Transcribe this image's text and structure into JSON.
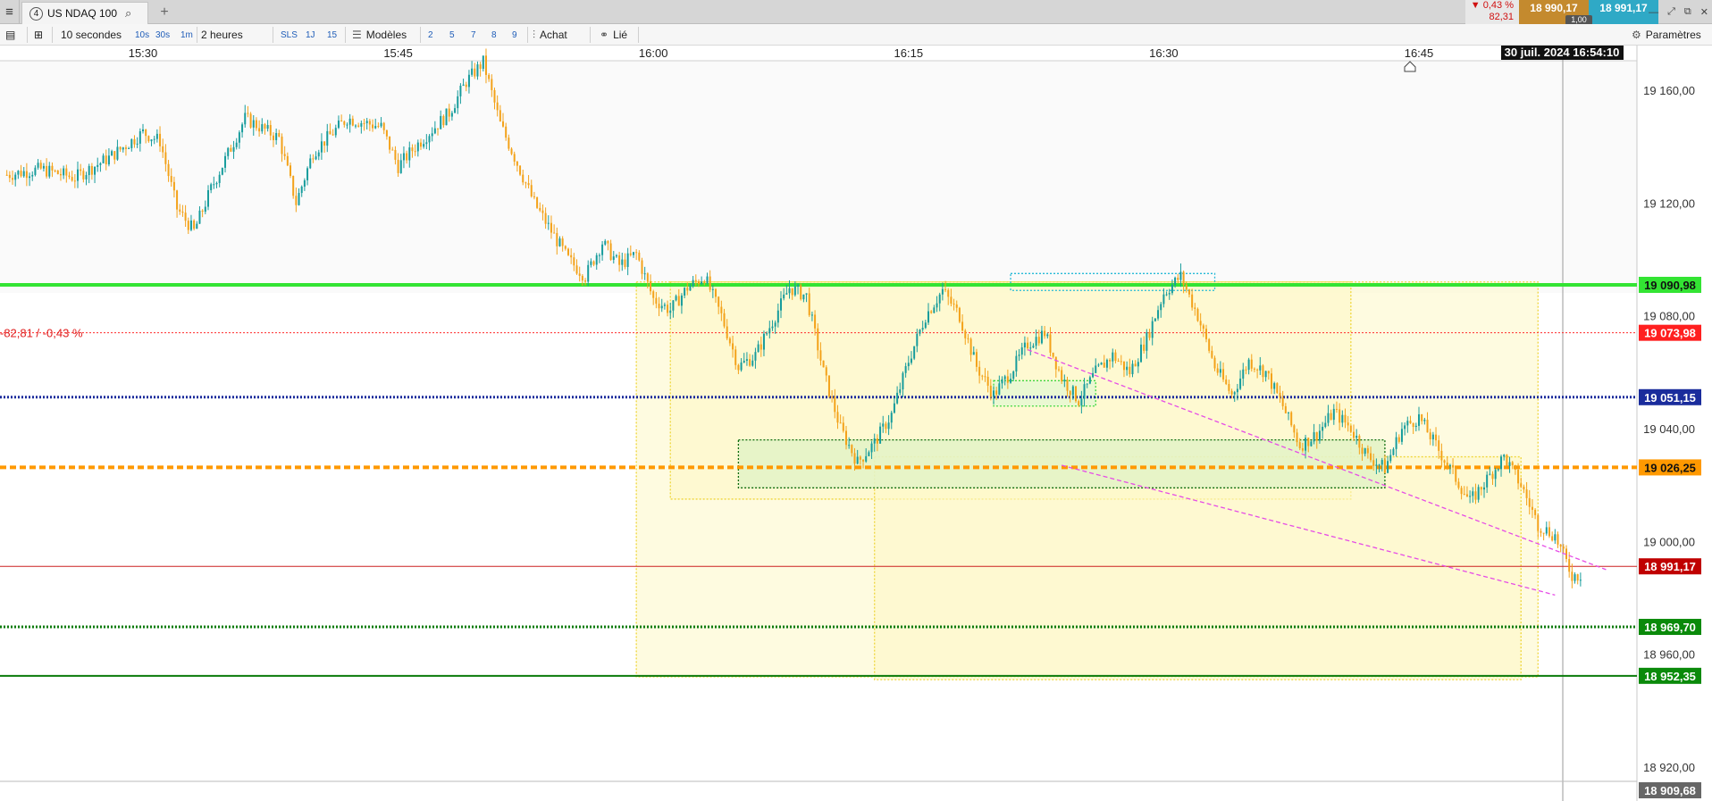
{
  "tab": {
    "number": "4",
    "title": "US NDAQ 100"
  },
  "quote": {
    "change_pct": "▼ 0,43 %",
    "change_pts": "82,31",
    "bid": "18 990,17",
    "ask": "18 991,17",
    "qty": "1,00"
  },
  "toolbar": {
    "interval": "10 secondes",
    "presets": [
      "10s",
      "30s",
      "1m"
    ],
    "range": "2 heures",
    "range_presets": [
      "SLS",
      "1J",
      "15"
    ],
    "models": "Modèles",
    "model_presets": [
      "2",
      "5",
      "7",
      "8",
      "9"
    ],
    "buy": "Achat",
    "linked": "Lié",
    "settings": "Paramètres"
  },
  "chart_data": {
    "type": "candlestick",
    "x_axis": {
      "range": [
        "15:22",
        "16:50"
      ],
      "tick_labels": [
        "15:30",
        "15:45",
        "16:00",
        "16:15",
        "16:30",
        "16:45"
      ]
    },
    "y_axis": {
      "range": [
        18905,
        19178
      ],
      "tick_labels": [
        "19 160,00",
        "19 120,00",
        "19 080,00",
        "19 040,00",
        "19 000,00",
        "18 960,00",
        "18 920,00"
      ],
      "side": "right"
    },
    "crosshair_time": "30 juil. 2024 16:54:10",
    "price_path": [
      [
        "15:22",
        19130
      ],
      [
        "15:24",
        19132
      ],
      [
        "15:26",
        19129
      ],
      [
        "15:28",
        19136
      ],
      [
        "15:30",
        19145
      ],
      [
        "15:31",
        19142
      ],
      [
        "15:32",
        19118
      ],
      [
        "15:33",
        19110
      ],
      [
        "15:34",
        19125
      ],
      [
        "15:36",
        19150
      ],
      [
        "15:38",
        19143
      ],
      [
        "15:39",
        19120
      ],
      [
        "15:40",
        19138
      ],
      [
        "15:42",
        19150
      ],
      [
        "15:44",
        19147
      ],
      [
        "15:45",
        19133
      ],
      [
        "15:46",
        19140
      ],
      [
        "15:48",
        19152
      ],
      [
        "15:49",
        19163
      ],
      [
        "15:50",
        19170
      ],
      [
        "15:51",
        19148
      ],
      [
        "15:52",
        19134
      ],
      [
        "15:53",
        19120
      ],
      [
        "15:54",
        19110
      ],
      [
        "15:55",
        19100
      ],
      [
        "15:56",
        19094
      ],
      [
        "15:57",
        19106
      ],
      [
        "15:58",
        19098
      ],
      [
        "15:59",
        19102
      ],
      [
        "16:00",
        19086
      ],
      [
        "16:01",
        19082
      ],
      [
        "16:02",
        19090
      ],
      [
        "16:03",
        19094
      ],
      [
        "16:04",
        19080
      ],
      [
        "16:05",
        19062
      ],
      [
        "16:06",
        19066
      ],
      [
        "16:07",
        19078
      ],
      [
        "16:08",
        19090
      ],
      [
        "16:09",
        19087
      ],
      [
        "16:10",
        19060
      ],
      [
        "16:11",
        19040
      ],
      [
        "16:12",
        19028
      ],
      [
        "16:13",
        19035
      ],
      [
        "16:14",
        19045
      ],
      [
        "16:15",
        19064
      ],
      [
        "16:16",
        19080
      ],
      [
        "16:17",
        19089
      ],
      [
        "16:18",
        19080
      ],
      [
        "16:19",
        19062
      ],
      [
        "16:20",
        19052
      ],
      [
        "16:21",
        19060
      ],
      [
        "16:22",
        19070
      ],
      [
        "16:23",
        19074
      ],
      [
        "16:24",
        19058
      ],
      [
        "16:25",
        19050
      ],
      [
        "16:26",
        19060
      ],
      [
        "16:27",
        19066
      ],
      [
        "16:28",
        19060
      ],
      [
        "16:29",
        19072
      ],
      [
        "16:30",
        19088
      ],
      [
        "16:31",
        19094
      ],
      [
        "16:32",
        19080
      ],
      [
        "16:33",
        19062
      ],
      [
        "16:34",
        19052
      ],
      [
        "16:35",
        19064
      ],
      [
        "16:36",
        19060
      ],
      [
        "16:37",
        19048
      ],
      [
        "16:38",
        19034
      ],
      [
        "16:39",
        19038
      ],
      [
        "16:40",
        19046
      ],
      [
        "16:41",
        19040
      ],
      [
        "16:42",
        19030
      ],
      [
        "16:43",
        19026
      ],
      [
        "16:44",
        19040
      ],
      [
        "16:45",
        19044
      ],
      [
        "16:46",
        19034
      ],
      [
        "16:47",
        19024
      ],
      [
        "16:48",
        19014
      ],
      [
        "16:49",
        19022
      ],
      [
        "16:50",
        19030
      ],
      [
        "16:51",
        19020
      ],
      [
        "16:52",
        19006
      ],
      [
        "16:53",
        19002
      ],
      [
        "16:54",
        18988
      ]
    ],
    "horizontal_lines": [
      {
        "price": 19090.98,
        "label": "19 090,98",
        "color": "#33e433",
        "style": "solid",
        "label_bg": "#33e433",
        "label_fg": "dark"
      },
      {
        "price": 19073.98,
        "label": "19 073,98",
        "color": "#ff2a2a",
        "style": "dotted",
        "label_bg": "#ff2020",
        "label_fg": "light",
        "left_note": "-82,81 / -0,43 %"
      },
      {
        "price": 19051.15,
        "label": "19 051,15",
        "color": "#1a2c9c",
        "style": "dotted",
        "label_bg": "#1a2c9c",
        "label_fg": "light"
      },
      {
        "price": 19026.25,
        "label": "19 026,25",
        "color": "#ff9900",
        "style": "dashed",
        "label_bg": "#ff9900",
        "label_fg": "dark"
      },
      {
        "price": 18991.17,
        "label": "18 991,17",
        "color": "#cc2020",
        "style": "thin",
        "label_bg": "#c00000",
        "label_fg": "light"
      },
      {
        "price": 18969.7,
        "label": "18 969,70",
        "color": "#0a7a0a",
        "style": "dotted",
        "label_bg": "#0a8a0a",
        "label_fg": "light"
      },
      {
        "price": 18952.35,
        "label": "18 952,35",
        "color": "#0a7a0a",
        "style": "solid",
        "label_bg": "#0a8a0a",
        "label_fg": "light"
      }
    ],
    "bottom_label": "18 909,68",
    "colors": {
      "up": "#179c9c",
      "down": "#f3a21a",
      "rect_fill": "#fdf8c7",
      "rect_stroke": "#efd63a",
      "trend": "#e64ce6"
    }
  }
}
